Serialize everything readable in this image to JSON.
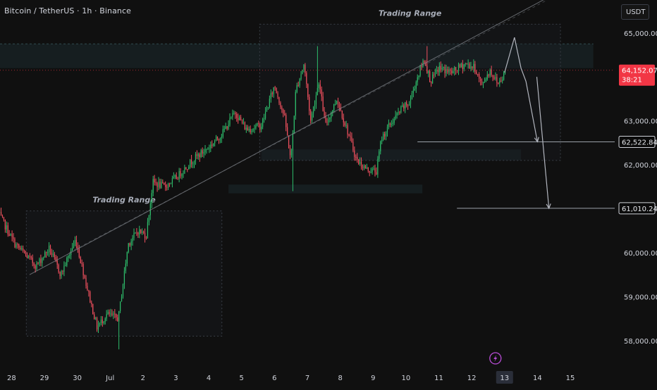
{
  "header": {
    "symbol_title": "Bitcoin / TetherUS · 1h · Binance"
  },
  "toolbar": {
    "currency_label": "USDT"
  },
  "price_axis": {
    "labels": [
      {
        "value": 65000,
        "text": "65,000.00"
      },
      {
        "value": 63000,
        "text": "63,000.00"
      },
      {
        "value": 62000,
        "text": "62,000.00"
      },
      {
        "value": 60000,
        "text": "60,000.00"
      },
      {
        "value": 59000,
        "text": "59,000.00"
      },
      {
        "value": 58000,
        "text": "58,000.00"
      }
    ],
    "current_price": {
      "value": 64152.07,
      "text": "64,152.07",
      "countdown": "38:21",
      "color": "#f23645"
    },
    "level_tags": [
      {
        "value": 62522.84,
        "text": "62,522.84"
      },
      {
        "value": 61010.24,
        "text": "61,010.24"
      }
    ]
  },
  "time_axis": {
    "labels": [
      {
        "t": 0,
        "text": "28"
      },
      {
        "t": 1,
        "text": "29"
      },
      {
        "t": 2,
        "text": "30"
      },
      {
        "t": 3,
        "text": "Jul"
      },
      {
        "t": 4,
        "text": "2"
      },
      {
        "t": 5,
        "text": "3"
      },
      {
        "t": 6,
        "text": "4"
      },
      {
        "t": 7,
        "text": "5"
      },
      {
        "t": 8,
        "text": "6"
      },
      {
        "t": 9,
        "text": "7"
      },
      {
        "t": 10,
        "text": "8"
      },
      {
        "t": 11,
        "text": "9"
      },
      {
        "t": 12,
        "text": "10"
      },
      {
        "t": 13,
        "text": "11"
      },
      {
        "t": 14,
        "text": "12"
      },
      {
        "t": 15,
        "text": "13"
      },
      {
        "t": 16,
        "text": "14"
      },
      {
        "t": 17,
        "text": "15"
      }
    ],
    "highlight_t": 15
  },
  "colors": {
    "background": "#101010",
    "up": "#26a69a",
    "down": "#ef5350",
    "up_bright": "#2ebd6b",
    "down_bright": "#f0505e",
    "annotation": "#b2b5be",
    "zone_fill": "#1b2a2e",
    "event_icon": "#b84cd6"
  },
  "chart_data": {
    "type": "candlestick",
    "timeframe": "1h",
    "ylim": [
      57500,
      65750
    ],
    "xlim": [
      -0.35,
      18.35
    ],
    "key_prices": [
      {
        "t": -0.95,
        "p": 60200
      },
      {
        "t": -0.4,
        "p": 60900
      },
      {
        "t": 0.1,
        "p": 60200
      },
      {
        "t": 0.75,
        "p": 59700
      },
      {
        "t": 1.15,
        "p": 60100
      },
      {
        "t": 1.5,
        "p": 59500
      },
      {
        "t": 1.95,
        "p": 60300
      },
      {
        "t": 2.3,
        "p": 59200
      },
      {
        "t": 2.6,
        "p": 58300
      },
      {
        "t": 2.9,
        "p": 58600
      },
      {
        "t": 3.25,
        "p": 58500
      },
      {
        "t": 3.55,
        "p": 60200
      },
      {
        "t": 3.85,
        "p": 60500
      },
      {
        "t": 4.1,
        "p": 60400
      },
      {
        "t": 4.3,
        "p": 61600
      },
      {
        "t": 4.65,
        "p": 61500
      },
      {
        "t": 5.0,
        "p": 61700
      },
      {
        "t": 5.5,
        "p": 62100
      },
      {
        "t": 6.0,
        "p": 62400
      },
      {
        "t": 6.4,
        "p": 62700
      },
      {
        "t": 6.8,
        "p": 63200
      },
      {
        "t": 7.15,
        "p": 62800
      },
      {
        "t": 7.6,
        "p": 62900
      },
      {
        "t": 8.0,
        "p": 63800
      },
      {
        "t": 8.3,
        "p": 63100
      },
      {
        "t": 8.5,
        "p": 62100
      },
      {
        "t": 8.65,
        "p": 63700
      },
      {
        "t": 8.9,
        "p": 64300
      },
      {
        "t": 9.1,
        "p": 63000
      },
      {
        "t": 9.35,
        "p": 63900
      },
      {
        "t": 9.55,
        "p": 62900
      },
      {
        "t": 9.9,
        "p": 63500
      },
      {
        "t": 10.25,
        "p": 62700
      },
      {
        "t": 10.5,
        "p": 62100
      },
      {
        "t": 10.8,
        "p": 61900
      },
      {
        "t": 11.1,
        "p": 61850
      },
      {
        "t": 11.25,
        "p": 62600
      },
      {
        "t": 11.5,
        "p": 62900
      },
      {
        "t": 11.9,
        "p": 63300
      },
      {
        "t": 12.1,
        "p": 63400
      },
      {
        "t": 12.35,
        "p": 64000
      },
      {
        "t": 12.55,
        "p": 64400
      },
      {
        "t": 12.75,
        "p": 63900
      },
      {
        "t": 13.0,
        "p": 64200
      },
      {
        "t": 13.4,
        "p": 64100
      },
      {
        "t": 13.8,
        "p": 64300
      },
      {
        "t": 14.1,
        "p": 64200
      },
      {
        "t": 14.3,
        "p": 63800
      },
      {
        "t": 14.55,
        "p": 64150
      },
      {
        "t": 14.8,
        "p": 63850
      },
      {
        "t": 15.05,
        "p": 64152.07
      }
    ],
    "spikes": [
      {
        "t": 3.25,
        "p": 57800
      },
      {
        "t": 8.55,
        "p": 61400
      },
      {
        "t": 9.3,
        "p": 64700
      },
      {
        "t": 12.65,
        "p": 64700
      }
    ],
    "trading_ranges": [
      {
        "label": "Trading Range",
        "t0": 0.45,
        "t1": 6.4,
        "p_low": 58100,
        "p_high": 60950
      },
      {
        "label": "Trading Range",
        "t0": 7.55,
        "t1": 16.7,
        "p_low": 62100,
        "p_high": 65200
      }
    ],
    "highlight_zones": [
      {
        "t0": -0.35,
        "t1": 17.7,
        "p_low": 64200,
        "p_high": 64750
      },
      {
        "t0": 7.6,
        "t1": 15.5,
        "p_low": 62100,
        "p_high": 62350
      },
      {
        "t0": 6.6,
        "t1": 12.5,
        "p_low": 61350,
        "p_high": 61550
      }
    ],
    "trendline": {
      "t0": 0.55,
      "p0": 59500,
      "t1": 17.8,
      "p1": 66400
    },
    "projection_path": [
      {
        "t": 15.0,
        "p": 64100
      },
      {
        "t": 15.3,
        "p": 64900
      },
      {
        "t": 15.5,
        "p": 64200
      },
      {
        "t": 15.65,
        "p": 63900
      },
      {
        "t": 16.0,
        "p": 62522.84
      }
    ],
    "projection_path_2": [
      {
        "t": 15.98,
        "p": 64000
      },
      {
        "t": 16.35,
        "p": 61010.24
      }
    ],
    "horizontal_levels": [
      {
        "t0": 12.35,
        "t1": 18.35,
        "p": 62522.84
      },
      {
        "t0": 13.55,
        "t1": 18.35,
        "p": 61010.24
      }
    ]
  }
}
